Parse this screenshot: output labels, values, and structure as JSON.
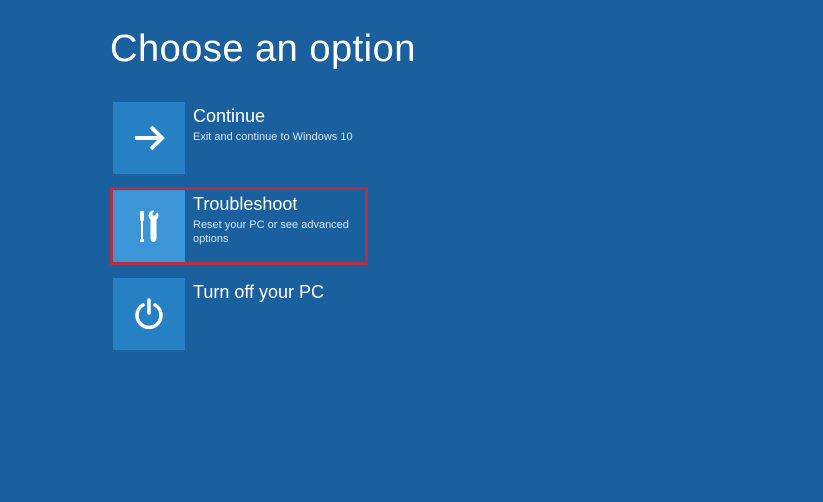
{
  "header": {
    "title": "Choose an option"
  },
  "options": [
    {
      "title": "Continue",
      "desc": "Exit and continue to Windows 10"
    },
    {
      "title": "Troubleshoot",
      "desc": "Reset your PC or see advanced options"
    },
    {
      "title": "Turn off your PC",
      "desc": ""
    }
  ],
  "colors": {
    "background": "#1a5f9e",
    "tile_normal": "#2581c4",
    "tile_selected": "#3b95d6",
    "highlight_border": "#b23046"
  }
}
